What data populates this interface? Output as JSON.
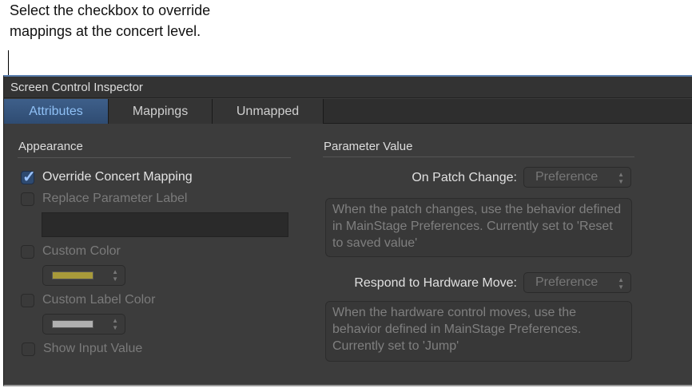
{
  "callout": {
    "text": "Select the checkbox to override mappings at the concert level."
  },
  "window": {
    "title": "Screen Control Inspector"
  },
  "tabs": [
    {
      "label": "Attributes",
      "active": true
    },
    {
      "label": "Mappings"
    },
    {
      "label": "Unmapped"
    }
  ],
  "appearance": {
    "title": "Appearance",
    "override": {
      "label": "Override Concert Mapping",
      "checked": true
    },
    "replace_label": {
      "label": "Replace Parameter Label",
      "checked": false,
      "value": ""
    },
    "custom_color": {
      "label": "Custom Color",
      "checked": false,
      "color": "#a89a3a"
    },
    "custom_label_color": {
      "label": "Custom Label Color",
      "checked": false,
      "color": "#b0b0b0"
    },
    "show_input": {
      "label": "Show Input Value",
      "checked": false
    }
  },
  "parameter_value": {
    "title": "Parameter Value",
    "patch_change": {
      "label": "On Patch Change:",
      "value": "Preference",
      "description": "When the patch changes, use the behavior defined in MainStage Preferences. Currently set to 'Reset to saved value'"
    },
    "hardware_move": {
      "label": "Respond to Hardware Move:",
      "value": "Preference",
      "description": "When the hardware control moves, use the behavior defined in MainStage Preferences. Currently set to 'Jump'"
    }
  },
  "icons": {
    "stepper": "up-down-arrows-icon",
    "check": "checkmark-icon"
  }
}
